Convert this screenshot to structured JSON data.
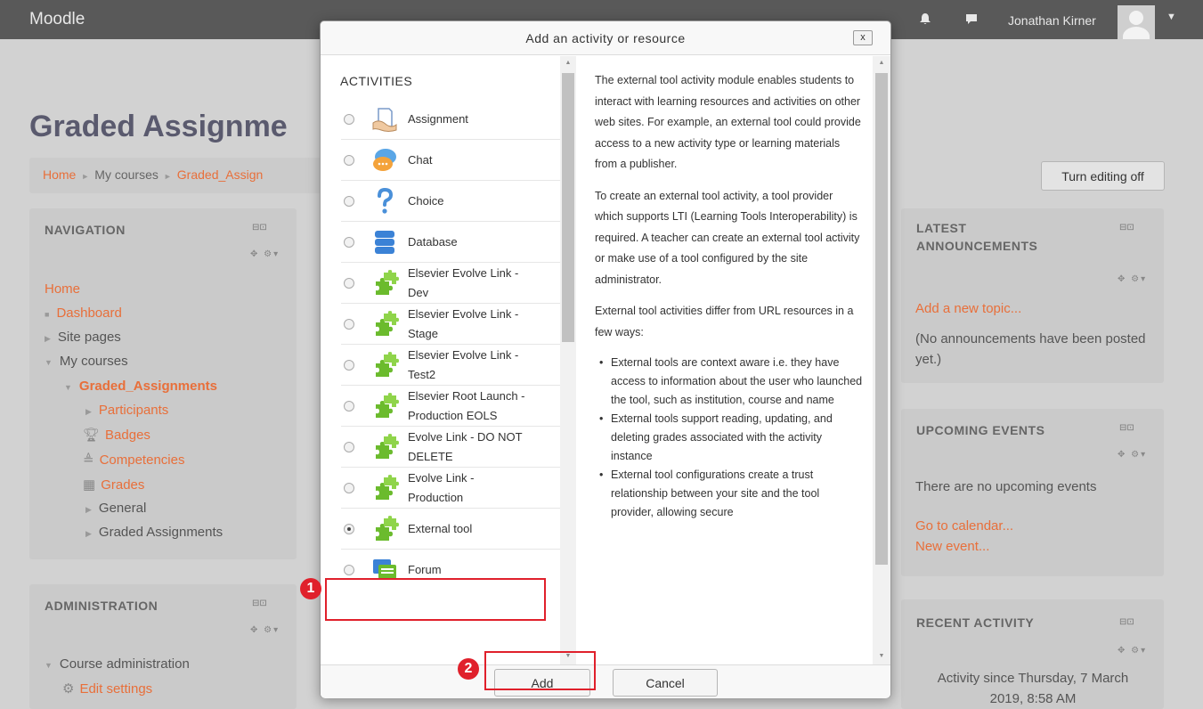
{
  "topbar": {
    "brand": "Moodle",
    "user_name": "Jonathan Kirner"
  },
  "page": {
    "title": "Graded Assignme",
    "breadcrumb": [
      "Home",
      "My courses",
      "Graded_Assign"
    ],
    "edit_button": "Turn editing off"
  },
  "navigation": {
    "title": "NAVIGATION",
    "items": {
      "home": "Home",
      "dashboard": "Dashboard",
      "site_pages": "Site pages",
      "my_courses": "My courses",
      "course": "Graded_Assignments",
      "participants": "Participants",
      "badges": "Badges",
      "competencies": "Competencies",
      "grades": "Grades",
      "general": "General",
      "graded_assignments": "Graded Assignments"
    }
  },
  "administration": {
    "title": "ADMINISTRATION",
    "course_admin": "Course administration",
    "edit_settings": "Edit settings"
  },
  "announcements": {
    "title_line1": "LATEST",
    "title_line2": "ANNOUNCEMENTS",
    "add_link": "Add a new topic...",
    "empty_text": "(No announcements have been posted yet.)"
  },
  "events": {
    "title": "UPCOMING EVENTS",
    "empty_text": "There are no upcoming events",
    "calendar_link": "Go to calendar...",
    "new_event_link": "New event..."
  },
  "recent": {
    "title": "RECENT ACTIVITY",
    "since_text": "Activity since Thursday, 7 March 2019, 8:58 AM"
  },
  "modal": {
    "title": "Add an activity or resource",
    "close_label": "x",
    "heading": "ACTIVITIES",
    "options": [
      {
        "line1": "Assignment",
        "line2": "",
        "icon": "assignment-icon",
        "selected": false
      },
      {
        "line1": "Chat",
        "line2": "",
        "icon": "chat-icon",
        "selected": false
      },
      {
        "line1": "Choice",
        "line2": "",
        "icon": "choice-icon",
        "selected": false
      },
      {
        "line1": "Database",
        "line2": "",
        "icon": "database-icon",
        "selected": false
      },
      {
        "line1": "Elsevier Evolve Link -",
        "line2": "Dev",
        "icon": "puzzle-icon",
        "selected": false
      },
      {
        "line1": "Elsevier Evolve Link -",
        "line2": "Stage",
        "icon": "puzzle-icon",
        "selected": false
      },
      {
        "line1": "Elsevier Evolve Link -",
        "line2": "Test2",
        "icon": "puzzle-icon",
        "selected": false
      },
      {
        "line1": "Elsevier Root Launch -",
        "line2": "Production EOLS",
        "icon": "puzzle-icon",
        "selected": false
      },
      {
        "line1": "Evolve Link - DO NOT",
        "line2": "DELETE",
        "icon": "puzzle-icon",
        "selected": false
      },
      {
        "line1": "Evolve Link -",
        "line2": "Production",
        "icon": "puzzle-icon",
        "selected": false
      },
      {
        "line1": "External tool",
        "line2": "",
        "icon": "puzzle-icon",
        "selected": true
      },
      {
        "line1": "Forum",
        "line2": "",
        "icon": "forum-icon",
        "selected": false
      }
    ],
    "description": {
      "p1": "The external tool activity module enables students to interact with learning resources and activities on other web sites. For example, an external tool could provide access to a new activity type or learning materials from a publisher.",
      "p2": "To create an external tool activity, a tool provider which supports LTI (Learning Tools Interoperability) is required. A teacher can create an external tool activity or make use of a tool configured by the site administrator.",
      "p3": "External tool activities differ from URL resources in a few ways:",
      "bullets": [
        "External tools are context aware i.e. they have access to information about the user who launched the tool, such as institution, course and name",
        "External tools support reading, updating, and deleting grades associated with the activity instance",
        "External tool configurations create a trust relationship between your site and the tool provider, allowing secure"
      ]
    },
    "add_button": "Add",
    "cancel_button": "Cancel"
  },
  "annotations": {
    "step1": "1",
    "step2": "2"
  },
  "colors": {
    "accent": "#e86f3a",
    "highlight": "#e0202b",
    "puzzle_green": "#6bbb2d"
  }
}
